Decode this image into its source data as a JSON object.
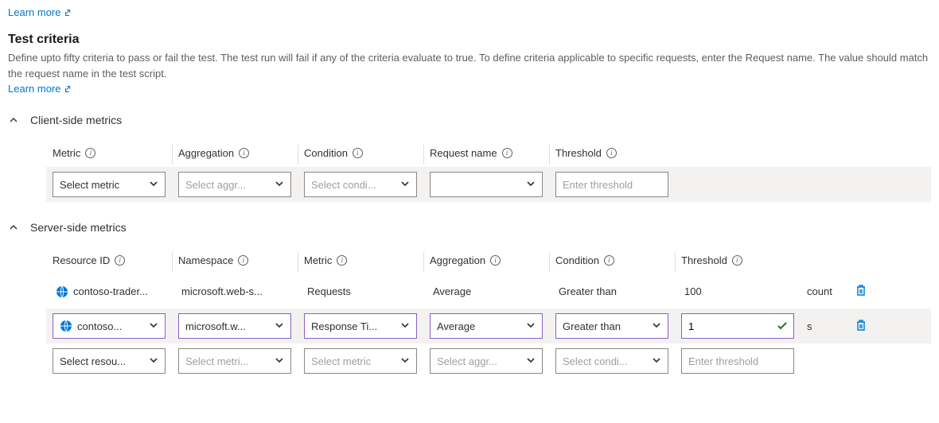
{
  "topLearnMore": "Learn more",
  "title": "Test criteria",
  "description": "Define upto fifty criteria to pass or fail the test. The test run will fail if any of the criteria evaluate to true. To define criteria applicable to specific requests, enter the Request name. The value should match the request name in the test script.",
  "bottomLearnMore": "Learn more",
  "client": {
    "header": "Client-side metrics",
    "columns": {
      "metric": "Metric",
      "agg": "Aggregation",
      "cond": "Condition",
      "req": "Request name",
      "thresh": "Threshold"
    },
    "row1": {
      "metric": "Select metric",
      "agg_ph": "Select aggr...",
      "cond_ph": "Select condi...",
      "thresh_ph": "Enter threshold"
    }
  },
  "server": {
    "header": "Server-side metrics",
    "columns": {
      "resid": "Resource ID",
      "ns": "Namespace",
      "metric": "Metric",
      "agg": "Aggregation",
      "cond": "Condition",
      "thresh": "Threshold"
    },
    "row1": {
      "resid": "contoso-trader...",
      "ns": "microsoft.web-s...",
      "metric": "Requests",
      "agg": "Average",
      "cond": "Greater than",
      "thresh": "100",
      "unit": "count"
    },
    "row2": {
      "resid": "contoso...",
      "ns": "microsoft.w...",
      "metric": "Response Ti...",
      "agg": "Average",
      "cond": "Greater than",
      "thresh": "1",
      "unit": "s"
    },
    "row3": {
      "resid_ph": "Select resou...",
      "ns_ph": "Select metri...",
      "metric_ph": "Select metric",
      "agg_ph": "Select aggr...",
      "cond_ph": "Select condi...",
      "thresh_ph": "Enter threshold"
    }
  }
}
